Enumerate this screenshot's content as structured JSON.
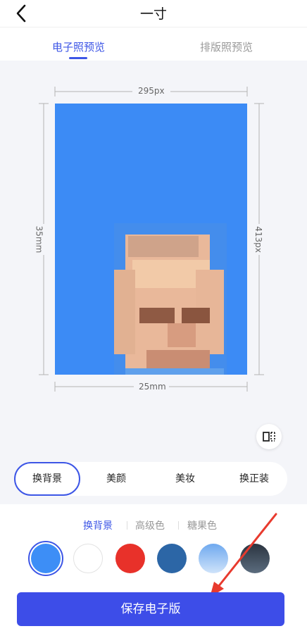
{
  "header": {
    "title": "一寸"
  },
  "tabs": [
    {
      "label": "电子照预览"
    },
    {
      "label": "排版照预览"
    }
  ],
  "preview": {
    "width_label": "295px",
    "height_label": "413px",
    "height_mm_label": "35mm",
    "width_mm_label": "25mm",
    "background_color": "#3c8bf5"
  },
  "edit_tabs": [
    {
      "label": "换背景"
    },
    {
      "label": "美颜"
    },
    {
      "label": "美妆"
    },
    {
      "label": "换正装"
    }
  ],
  "bg_subtabs": [
    {
      "label": "换背景"
    },
    {
      "label": "高级色"
    },
    {
      "label": "糖果色"
    }
  ],
  "swatches": [
    {
      "name": "blue",
      "color": "#3d8ef6",
      "selected": true
    },
    {
      "name": "white",
      "color": "#ffffff"
    },
    {
      "name": "red",
      "color": "#e8312a"
    },
    {
      "name": "dark-blue",
      "color": "#2c66a6"
    },
    {
      "name": "light-blue-gradient",
      "color": "#a8cdf5"
    },
    {
      "name": "dark-gray-gradient",
      "color": "#3a4552"
    }
  ],
  "action": {
    "save_label": "保存电子版"
  }
}
